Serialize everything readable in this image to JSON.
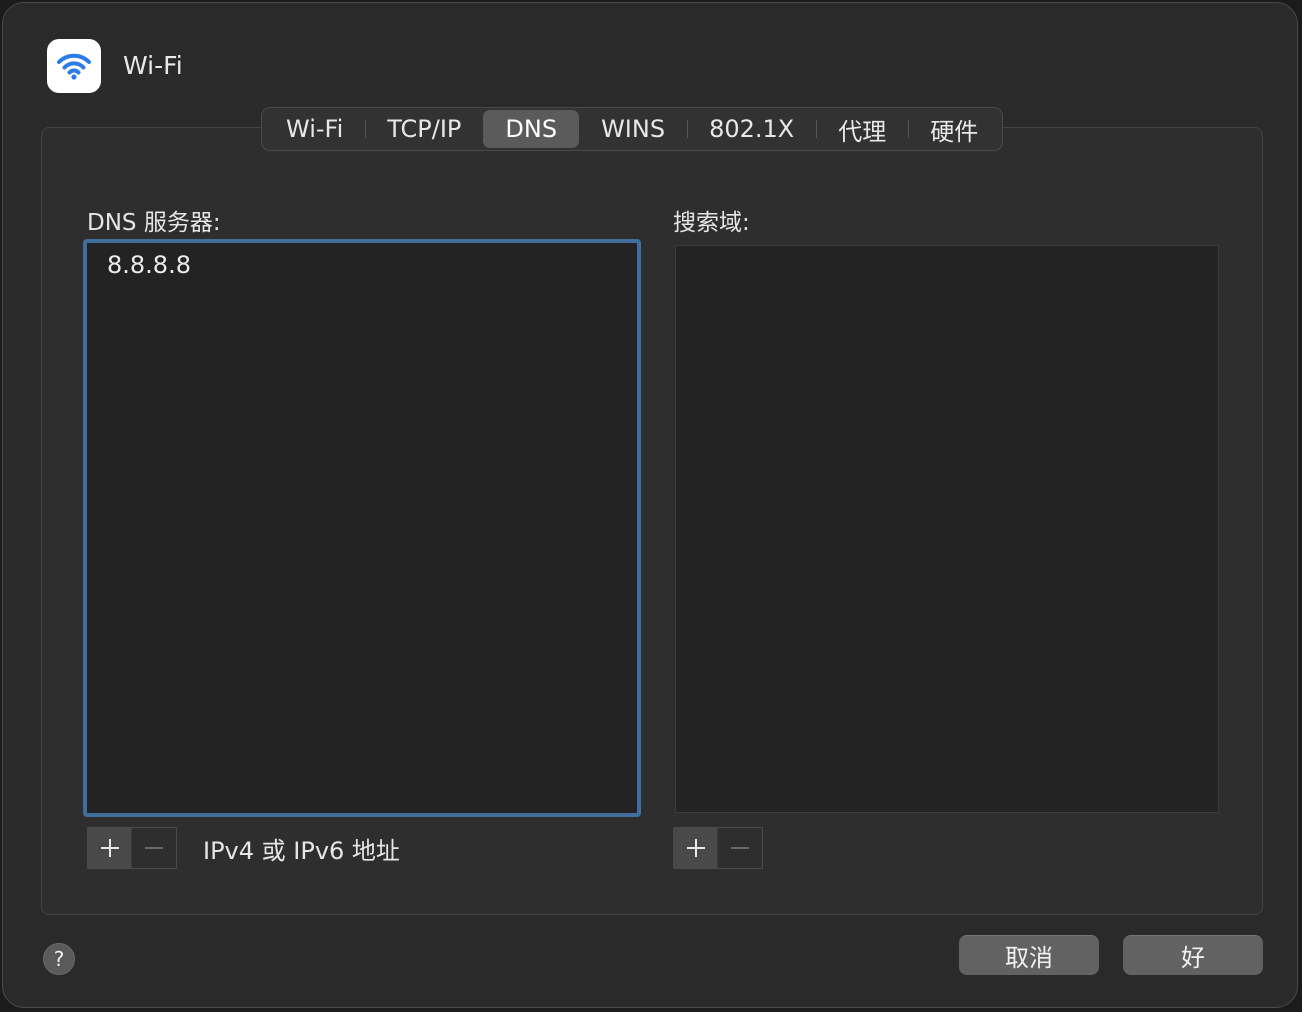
{
  "window": {
    "title": "Wi-Fi",
    "app_icon": "wifi-icon"
  },
  "tabs": [
    {
      "label": "Wi-Fi",
      "active": false
    },
    {
      "label": "TCP/IP",
      "active": false
    },
    {
      "label": "DNS",
      "active": true
    },
    {
      "label": "WINS",
      "active": false
    },
    {
      "label": "802.1X",
      "active": false
    },
    {
      "label": "代理",
      "active": false
    },
    {
      "label": "硬件",
      "active": false
    }
  ],
  "dns_servers": {
    "label": "DNS 服务器:",
    "items": [
      "8.8.8.8"
    ],
    "hint": "IPv4 或 IPv6 地址"
  },
  "search_domains": {
    "label": "搜索域:",
    "items": []
  },
  "controls": {
    "add": "+",
    "remove": "—"
  },
  "footer": {
    "help": "?",
    "cancel": "取消",
    "ok": "好"
  },
  "colors": {
    "accent_focus": "#3f6f9f",
    "wifi_blue": "#2b7de9"
  }
}
